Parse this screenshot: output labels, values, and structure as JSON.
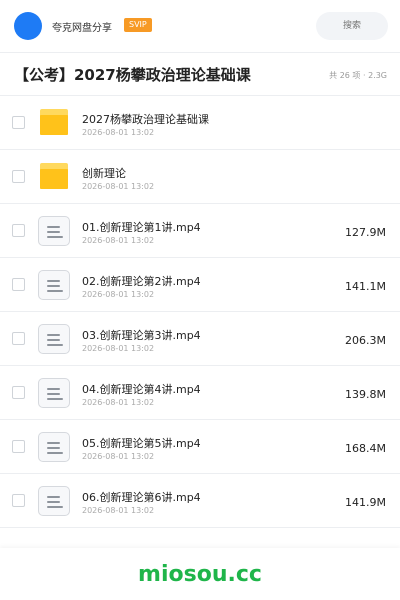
{
  "header": {
    "site_name": "夸克网盘分享",
    "badge": "SVIP",
    "search_placeholder": "搜索"
  },
  "share": {
    "title": "【公考】2027杨攀政治理论基础课",
    "summary": "共 26 项 · 2.3G"
  },
  "items": [
    {
      "type": "folder",
      "name": "2027杨攀政治理论基础课",
      "date": "2026-08-01 13:02",
      "size": ""
    },
    {
      "type": "folder",
      "name": "创新理论",
      "date": "2026-08-01 13:02",
      "size": ""
    },
    {
      "type": "file",
      "name": "01.创新理论第1讲.mp4",
      "date": "2026-08-01 13:02",
      "size": "127.9M"
    },
    {
      "type": "file",
      "name": "02.创新理论第2讲.mp4",
      "date": "2026-08-01 13:02",
      "size": "141.1M"
    },
    {
      "type": "file",
      "name": "03.创新理论第3讲.mp4",
      "date": "2026-08-01 13:02",
      "size": "206.3M"
    },
    {
      "type": "file",
      "name": "04.创新理论第4讲.mp4",
      "date": "2026-08-01 13:02",
      "size": "139.8M"
    },
    {
      "type": "file",
      "name": "05.创新理论第5讲.mp4",
      "date": "2026-08-01 13:02",
      "size": "168.4M"
    },
    {
      "type": "file",
      "name": "06.创新理论第6讲.mp4",
      "date": "2026-08-01 13:02",
      "size": "141.9M"
    }
  ],
  "footer": {
    "brand": "miosou.cc"
  },
  "colors": {
    "accent": "#1e7bf5",
    "badge": "#f79a25",
    "folder": "#ffc21a",
    "brand": "#1fb54a"
  }
}
